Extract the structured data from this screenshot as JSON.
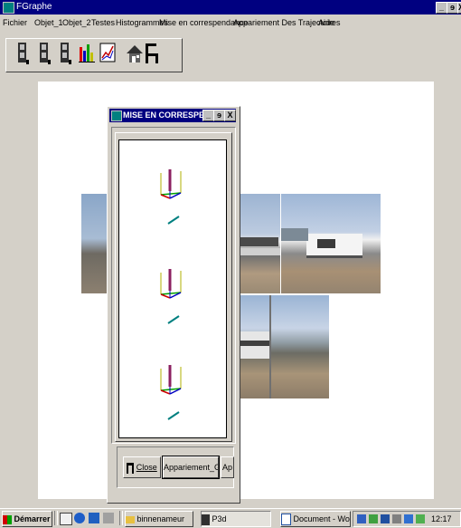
{
  "window": {
    "title": "FGraphe",
    "controls": [
      "_",
      "ɘ",
      "X"
    ]
  },
  "menu": {
    "items": [
      "Fichier",
      "Objet_1",
      "Objet_2",
      "Testes",
      "Histogrammes",
      "Mise en correspendance",
      "Appariement Des Trajectoires",
      "Aide"
    ]
  },
  "toolbar": {
    "tools": [
      "object-1-icon",
      "object-2-icon",
      "object-3-icon",
      "histogram-icon",
      "graph-icon",
      "house-icon",
      "chair-icon"
    ]
  },
  "dialog": {
    "title": "MISE EN CORRESPEN...",
    "controls": [
      "_",
      "ɘ",
      "X"
    ],
    "buttons": {
      "close": "Close",
      "appariement": "Appariement_G",
      "ap": "Ap"
    }
  },
  "taskbar": {
    "start": "Démarrer",
    "tasks": [
      "binnenameur",
      "P3d",
      "Document - WordPad"
    ],
    "clock": "12:17"
  },
  "colors": {
    "titlebar": "#000080",
    "face": "#d4d0c8",
    "desktop": "#008080"
  }
}
